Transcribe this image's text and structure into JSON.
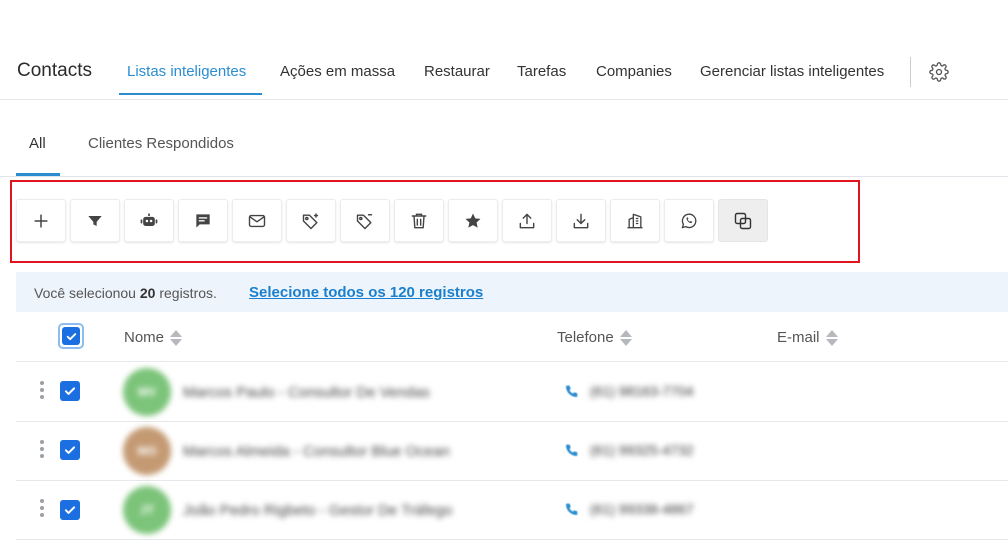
{
  "app": {
    "title": "Contacts"
  },
  "nav": {
    "tabs": [
      {
        "label": "Listas inteligentes"
      },
      {
        "label": "Ações em massa"
      },
      {
        "label": "Restaurar"
      },
      {
        "label": "Tarefas"
      },
      {
        "label": "Companies"
      },
      {
        "label": "Gerenciar listas inteligentes"
      }
    ],
    "active_tab": "Listas inteligentes",
    "settings_icon": "gear-icon"
  },
  "subtabs": {
    "items": [
      {
        "label": "All"
      },
      {
        "label": "Clientes Respondidos"
      }
    ],
    "active": "All"
  },
  "toolbar": {
    "buttons": [
      {
        "icon": "plus-icon",
        "action": "add"
      },
      {
        "icon": "filter-icon",
        "action": "filter"
      },
      {
        "icon": "robot-icon",
        "action": "automation"
      },
      {
        "icon": "message-icon",
        "action": "sms"
      },
      {
        "icon": "mail-icon",
        "action": "email"
      },
      {
        "icon": "tag-add-icon",
        "action": "add-tag"
      },
      {
        "icon": "tag-remove-icon",
        "action": "remove-tag"
      },
      {
        "icon": "trash-icon",
        "action": "delete"
      },
      {
        "icon": "star-icon",
        "action": "review"
      },
      {
        "icon": "upload-icon",
        "action": "export"
      },
      {
        "icon": "download-icon",
        "action": "import"
      },
      {
        "icon": "building-icon",
        "action": "company"
      },
      {
        "icon": "whatsapp-icon",
        "action": "whatsapp"
      },
      {
        "icon": "merge-icon",
        "action": "merge"
      }
    ],
    "highlight_color": "#e0141e"
  },
  "selection": {
    "prefix": "Você selecionou",
    "count": "20",
    "suffix": "registros.",
    "select_all_link": "Selecione todos os 120 registros"
  },
  "table": {
    "columns": [
      {
        "label": "Nome"
      },
      {
        "label": "Telefone"
      },
      {
        "label": "E-mail"
      }
    ],
    "rows": [
      {
        "initials": "MV",
        "avatar_color": "#7cc47a",
        "name": "Marcos Paulo - Consultor De Vendas",
        "phone": "(61) 98163-7704",
        "checked": true
      },
      {
        "initials": "MO",
        "avatar_color": "#c49a73",
        "name": "Marcos Almeida - Consultor Blue Ocean",
        "phone": "(61) 99325-4732",
        "checked": true
      },
      {
        "initials": "JT",
        "avatar_color": "#7cc47a",
        "name": "João Pedro Rigbeto - Gestor De Tráfego",
        "phone": "(61) 99338-4867",
        "checked": true
      }
    ]
  },
  "colors": {
    "accent": "#2b8dd0",
    "link": "#1a80cd",
    "checkbox": "#1c6fe0",
    "banner_bg": "#eef4fb"
  }
}
